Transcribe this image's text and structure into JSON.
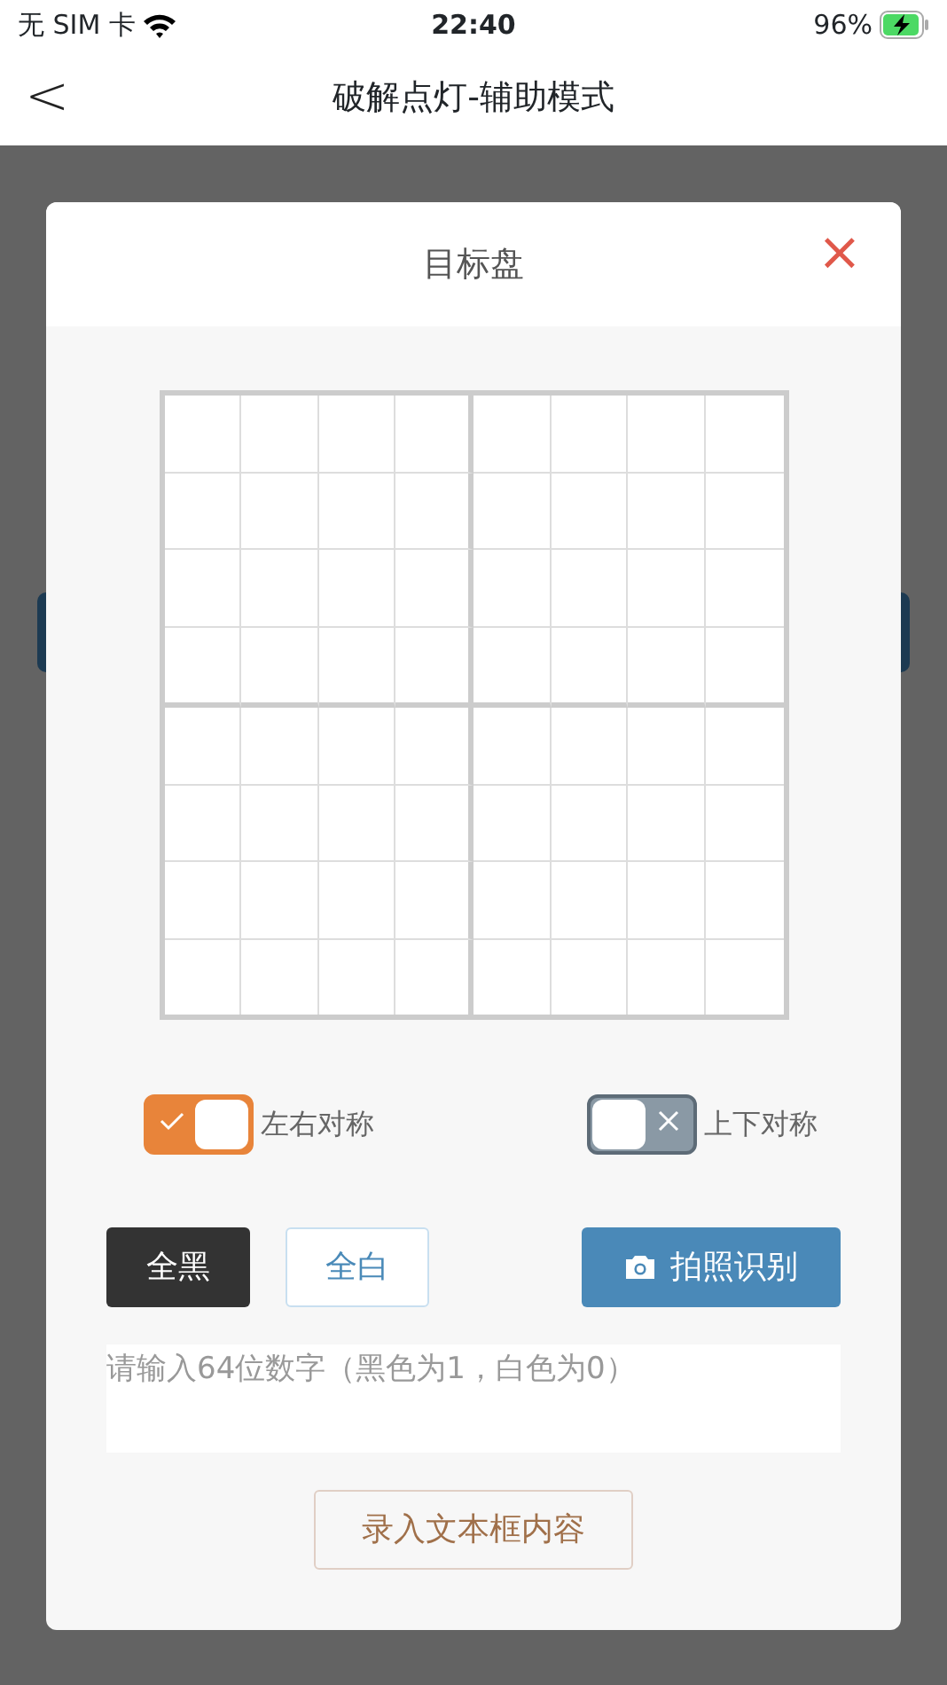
{
  "status_bar": {
    "carrier": "无 SIM 卡",
    "time": "22:40",
    "battery": "96%",
    "charging": true
  },
  "nav": {
    "back": "<",
    "title": "破解点灯-辅助模式"
  },
  "dialog": {
    "title": "目标盘",
    "close": "×",
    "board": {
      "cells_black": [
        [
          false,
          false,
          false,
          false,
          false,
          false,
          false,
          false
        ],
        [
          false,
          false,
          false,
          false,
          false,
          false,
          false,
          false
        ],
        [
          false,
          false,
          false,
          false,
          false,
          false,
          false,
          false
        ],
        [
          false,
          false,
          false,
          false,
          false,
          false,
          false,
          false
        ],
        [
          false,
          false,
          false,
          false,
          false,
          false,
          false,
          false
        ],
        [
          false,
          false,
          false,
          false,
          false,
          false,
          false,
          false
        ],
        [
          false,
          false,
          false,
          false,
          false,
          false,
          false,
          false
        ],
        [
          false,
          false,
          false,
          false,
          false,
          false,
          false,
          false
        ]
      ]
    },
    "toggles": [
      {
        "label": "左右对称",
        "on": true
      },
      {
        "label": "上下对称",
        "on": false
      }
    ],
    "buttons": [
      {
        "kind": "dark",
        "label": "全黑"
      },
      {
        "kind": "outline",
        "label": "全白"
      },
      {
        "kind": "camera",
        "label": "拍照识别"
      }
    ],
    "input": {
      "placeholder": "请输入64位数字（黑色为1，白色为0）"
    },
    "submit": "录入文本框内容"
  }
}
